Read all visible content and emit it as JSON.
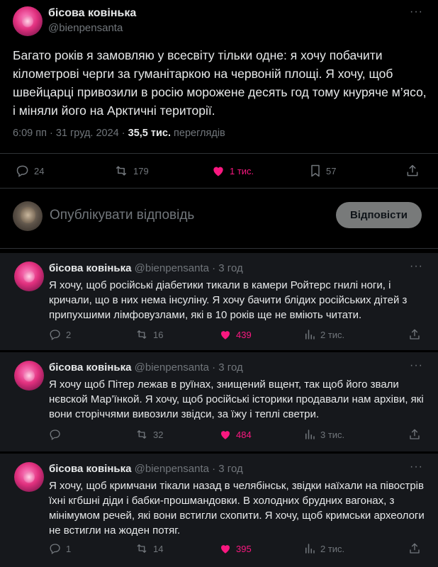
{
  "main_post": {
    "name": "бісова ковінька",
    "handle": "@bienpensanta",
    "text": "Багато років я замовляю у всесвіту тільки одне: я хочу побачити кілометрові черги за гуманітаркою на червоній площі. Я хочу, щоб швейцарці привозили в росію морожене десять год тому кнуряче м’ясо, і міняли його на Арктичні території.",
    "time": "6:09 пп",
    "date": "31 груд. 2024",
    "views_count": "35,5 тис.",
    "views_label": "переглядів",
    "more_glyph": "···",
    "replies": "24",
    "reposts": "179",
    "likes": "1 тис.",
    "bookmarks": "57"
  },
  "reply_box": {
    "placeholder": "Опублікувати відповідь",
    "button_label": "Відповісти"
  },
  "replies": [
    {
      "name": "бісова ковінька",
      "handle": "@bienpensanta",
      "time": "3 год",
      "text": "Я хочу, щоб російські діабетики тикали в камери Ройтерс гнилі ноги, і кричали, що в них нема інсуліну. Я хочу бачити блідих російських дітей з припухшими лімфовузлами, які в 10 років ще не вміють читати.",
      "replies": "2",
      "reposts": "16",
      "likes": "439",
      "views": "2 тис."
    },
    {
      "name": "бісова ковінька",
      "handle": "@bienpensanta",
      "time": "3 год",
      "text": "Я хочу щоб Пітер лежав в руїнах, знищений вщент, так щоб його звали нєвской Мар’їнкой. Я хочу, щоб російські історики продавали нам архіви, які вони сторіччями вивозили звідси, за їжу і теплі светри.",
      "replies": "",
      "reposts": "32",
      "likes": "484",
      "views": "3 тис."
    },
    {
      "name": "бісова ковінька",
      "handle": "@bienpensanta",
      "time": "3 год",
      "text": "Я хочу, щоб кримчани тікали назад в челябінськ, звідки наїхали на півострів їхні кгбшні діди і бабки-прошмандовки. В холодних брудних вагонах, з мінімумом речей, які вони встигли схопити. Я хочу, щоб кримськи археологи не встигли на жоден потяг.",
      "replies": "1",
      "reposts": "14",
      "likes": "395",
      "views": "2 тис."
    }
  ],
  "colors": {
    "background": "#000000",
    "reply_background": "#16181c",
    "text": "#e7e9ea",
    "muted": "#71767b",
    "like": "#f91880",
    "separator": "#2f3336"
  }
}
